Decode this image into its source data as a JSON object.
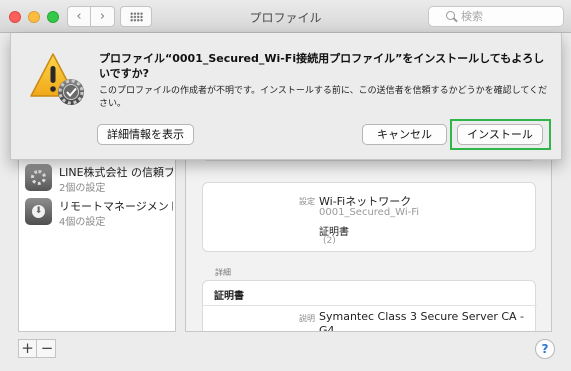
{
  "window": {
    "title": "プロファイル",
    "search_placeholder": "検索",
    "back_glyph": "‹",
    "forward_glyph": "›"
  },
  "dialog": {
    "title": "プロファイル“0001_Secured_Wi-Fi接続用プロファイル”をインストールしてもよろしいですか?",
    "message": "このプロファイルの作成者が不明です。インストールする前に、この送信者を信頼するかどうかを確認してください。",
    "details_button": "詳細情報を表示",
    "cancel_button": "キャンセル",
    "install_button": "インストール",
    "icon": "warning-gear-icon",
    "highlight_color": "#2fb54a"
  },
  "sidebar": {
    "items": [
      {
        "label": "LINE株式会社 の信頼プ...",
        "sub": "2個の設定",
        "icon": "settings-profile-icon"
      },
      {
        "label": "リモートマネージメント",
        "sub": "4個の設定",
        "icon": "remote-management-icon"
      }
    ],
    "add_label": "+",
    "remove_label": "−"
  },
  "detail": {
    "settings_key": "設定",
    "settings_value": "Wi-Fiネットワーク",
    "network_name": "0001_Secured_Wi-Fi",
    "cert_label": "証明書",
    "cert_count": "(2)",
    "section_label": "詳細",
    "cert_heading": "証明書",
    "desc_key": "説明",
    "desc_value_line1": "Symantec Class 3 Secure Server CA -",
    "desc_value_line2": "G4"
  },
  "help_label": "?"
}
